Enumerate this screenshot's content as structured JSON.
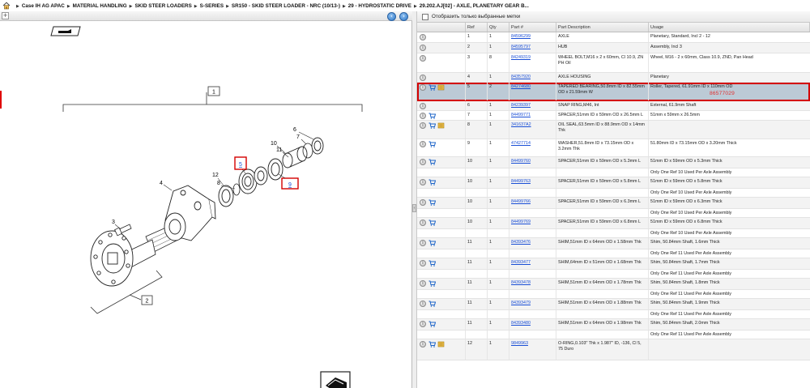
{
  "breadcrumb": [
    "Case IH AG APAC",
    "MATERIAL HANDLING",
    "SKID STEER LOADERS",
    "S-SERIES",
    "SR150 - SKID STEER LOADER - NRC (10/13-)",
    "29 - HYDROSTATIC DRIVE",
    "29.202.AJ[02] - AXLE, PLANETARY GEAR B..."
  ],
  "left_toolbar": {
    "expand_label": "+",
    "prev_label": "‹",
    "next_label": "›"
  },
  "diagram": {
    "callouts": [
      "1",
      "2",
      "3",
      "4",
      "5",
      "6",
      "7",
      "8",
      "9",
      "10",
      "11",
      "12"
    ],
    "highlighted_callouts": [
      "5",
      "9"
    ]
  },
  "splitter": {
    "grip_label": "‹"
  },
  "filter": {
    "label": "Отобразить только выбранные метки",
    "checked": false
  },
  "table": {
    "headers": {
      "ref": "Ref",
      "qty": "Qty",
      "part": "Part #",
      "desc": "Part Description",
      "usage": "Usage"
    },
    "rows": [
      {
        "ref": "1",
        "qty": "1",
        "part": "84596299",
        "desc": "AXLE",
        "usage": "Planetary, Standard, Incl 2 - 12",
        "cart": false,
        "note": false
      },
      {
        "ref": "2",
        "qty": "1",
        "part": "84595797",
        "desc": "HUB",
        "usage": "Assembly, Incl 3",
        "cart": false,
        "note": false
      },
      {
        "ref": "3",
        "qty": "8",
        "part": "84249319",
        "desc": "WHEEL BOLT,M16 x 2 x 60mm, Cl 10.9, ZN PH Oil",
        "usage": "Wheel, M16 - 2 x 60mm, Class 10.9, ZND, Pan Head",
        "cart": false,
        "note": false
      },
      {
        "ref": "4",
        "qty": "1",
        "part": "84357920",
        "desc": "AXLE HOUSING",
        "usage": "Planetary",
        "cart": false,
        "note": false
      },
      {
        "ref": "5",
        "qty": "2",
        "part": "84274680",
        "desc": "TAPERED BEARING,50.8mm ID x 82.55mm OD x 21.59mm W",
        "usage": "Roller, Tapered, 61.91mm ID x 110mm OD",
        "cart": true,
        "note": true,
        "selected": true,
        "alt_number": "86577029"
      },
      {
        "ref": "6",
        "qty": "1",
        "part": "84239397",
        "desc": "SNAP RING,M46, Int",
        "usage": "External, 61.9mm Shaft",
        "cart": false,
        "note": false
      },
      {
        "ref": "7",
        "qty": "1",
        "part": "84499771",
        "desc": "SPACER,51mm ID x 59mm OD x 26.5mm L",
        "usage": "51mm x 59mm x 26.5mm",
        "cart": true,
        "note": false
      },
      {
        "ref": "8",
        "qty": "1",
        "part": "341637A2",
        "desc": "OIL SEAL,63.5mm ID x 88.9mm OD x 14mm Thk",
        "usage": "",
        "cart": true,
        "note": true
      },
      {
        "ref": "9",
        "qty": "1",
        "part": "47427714",
        "desc": "WASHER,51.8mm ID x 73.15mm OD x 3.2mm Thk",
        "usage": "51.80mm ID x 73.15mm OD x 3.20mm Thick",
        "cart": true,
        "note": false
      },
      {
        "ref": "10",
        "qty": "1",
        "part": "84499760",
        "desc": "SPACER,51mm ID x 59mm OD x 5.3mm L",
        "usage": "51mm ID x 59mm OD x 5.3mm Thick",
        "cart": true,
        "note": false
      },
      {
        "ref": "",
        "qty": "",
        "part": "",
        "desc": "",
        "usage": "Only One Ref 10 Used Per Axle Assembly",
        "sub": true
      },
      {
        "ref": "10",
        "qty": "1",
        "part": "84499763",
        "desc": "SPACER,51mm ID x 59mm OD x 5.8mm L",
        "usage": "51mm ID x 59mm OD x 5.8mm Thick",
        "cart": true,
        "note": false
      },
      {
        "ref": "",
        "qty": "",
        "part": "",
        "desc": "",
        "usage": "Only One Ref 10 Used Per Axle Assembly",
        "sub": true
      },
      {
        "ref": "10",
        "qty": "1",
        "part": "84499766",
        "desc": "SPACER,51mm ID x 59mm OD x 6.3mm L",
        "usage": "51mm ID x 59mm OD x 6.3mm Thick",
        "cart": true,
        "note": false
      },
      {
        "ref": "",
        "qty": "",
        "part": "",
        "desc": "",
        "usage": "Only One Ref 10 Used Per Axle Assembly",
        "sub": true
      },
      {
        "ref": "10",
        "qty": "1",
        "part": "84499769",
        "desc": "SPACER,51mm ID x 59mm OD x 6.8mm L",
        "usage": "51mm ID x 59mm OD x 6.8mm Thick",
        "cart": true,
        "note": false
      },
      {
        "ref": "",
        "qty": "",
        "part": "",
        "desc": "",
        "usage": "Only One Ref 10 Used Per Axle Assembly",
        "sub": true
      },
      {
        "ref": "11",
        "qty": "1",
        "part": "84393476",
        "desc": "SHIM,51mm ID x 64mm OD x 1.58mm Thk",
        "usage": "Shim, 50.84mm Shaft, 1.6mm Thick",
        "cart": true,
        "note": false
      },
      {
        "ref": "",
        "qty": "",
        "part": "",
        "desc": "",
        "usage": "Only One Ref 11 Used Per Axle Assembly",
        "sub": true
      },
      {
        "ref": "11",
        "qty": "1",
        "part": "84393477",
        "desc": "SHIM,64mm ID x 51mm OD x 1.68mm Thk",
        "usage": "Shim, 50.84mm Shaft, 1.7mm Thick",
        "cart": true,
        "note": false
      },
      {
        "ref": "",
        "qty": "",
        "part": "",
        "desc": "",
        "usage": "Only One Ref 11 Used Per Axle Assembly",
        "sub": true
      },
      {
        "ref": "11",
        "qty": "1",
        "part": "84393478",
        "desc": "SHIM,51mm ID x 64mm OD x 1.78mm Thk",
        "usage": "Shim, 50.84mm Shaft, 1.8mm Thick",
        "cart": true,
        "note": false
      },
      {
        "ref": "",
        "qty": "",
        "part": "",
        "desc": "",
        "usage": "Only One Ref 11 Used Per Axle Assembly",
        "sub": true
      },
      {
        "ref": "11",
        "qty": "1",
        "part": "84393479",
        "desc": "SHIM,51mm ID x 64mm OD x 1.88mm Thk",
        "usage": "Shim, 50.84mm Shaft, 1.9mm Thick",
        "cart": true,
        "note": false
      },
      {
        "ref": "",
        "qty": "",
        "part": "",
        "desc": "",
        "usage": "Only One Ref 11 Used Per Axle Assembly",
        "sub": true
      },
      {
        "ref": "11",
        "qty": "1",
        "part": "84393480",
        "desc": "SHIM,51mm ID x 64mm OD x 1.98mm Thk",
        "usage": "Shim, 50.84mm Shaft, 2.0mm Thick",
        "cart": true,
        "note": false
      },
      {
        "ref": "",
        "qty": "",
        "part": "",
        "desc": "",
        "usage": "Only One Ref 11 Used Per Axle Assembly",
        "sub": true
      },
      {
        "ref": "12",
        "qty": "1",
        "part": "9849963",
        "desc": "O-RING,0.103\" Thk x 1.987\" ID, -136, Cl 5, 75 Duro",
        "usage": "",
        "cart": true,
        "note": true
      }
    ]
  },
  "colors": {
    "selected_row_bg": "#bccad6",
    "highlight_red": "#d40000",
    "link_blue": "#1a4fd6",
    "alt_number_red": "#e03030",
    "nav_button_blue": "#2f79c9"
  }
}
